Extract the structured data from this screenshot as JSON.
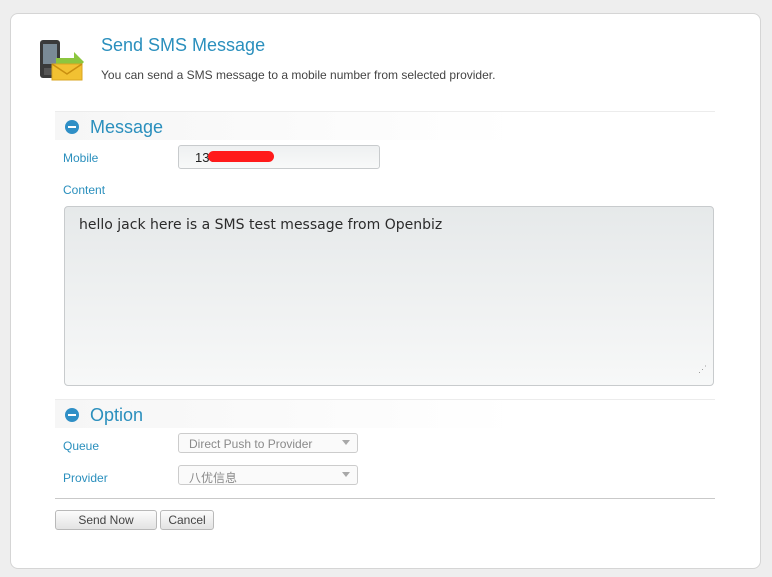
{
  "header": {
    "title": "Send SMS Message",
    "subtitle": "You can send a SMS message to a mobile number from selected provider.",
    "icon": "mobile-sms-icon"
  },
  "message_section": {
    "title": "Message",
    "mobile_label": "Mobile",
    "mobile_value": "130",
    "content_label": "Content",
    "content_value": "hello jack here is a SMS test message from Openbiz"
  },
  "option_section": {
    "title": "Option",
    "queue_label": "Queue",
    "queue_value": "Direct Push to Provider",
    "provider_label": "Provider",
    "provider_value": "八优信息"
  },
  "actions": {
    "send_label": "Send Now",
    "cancel_label": "Cancel"
  },
  "colors": {
    "accent": "#2a8fbd",
    "collapse_icon": "#2f8fc6",
    "redaction": "#ff1a1a"
  }
}
